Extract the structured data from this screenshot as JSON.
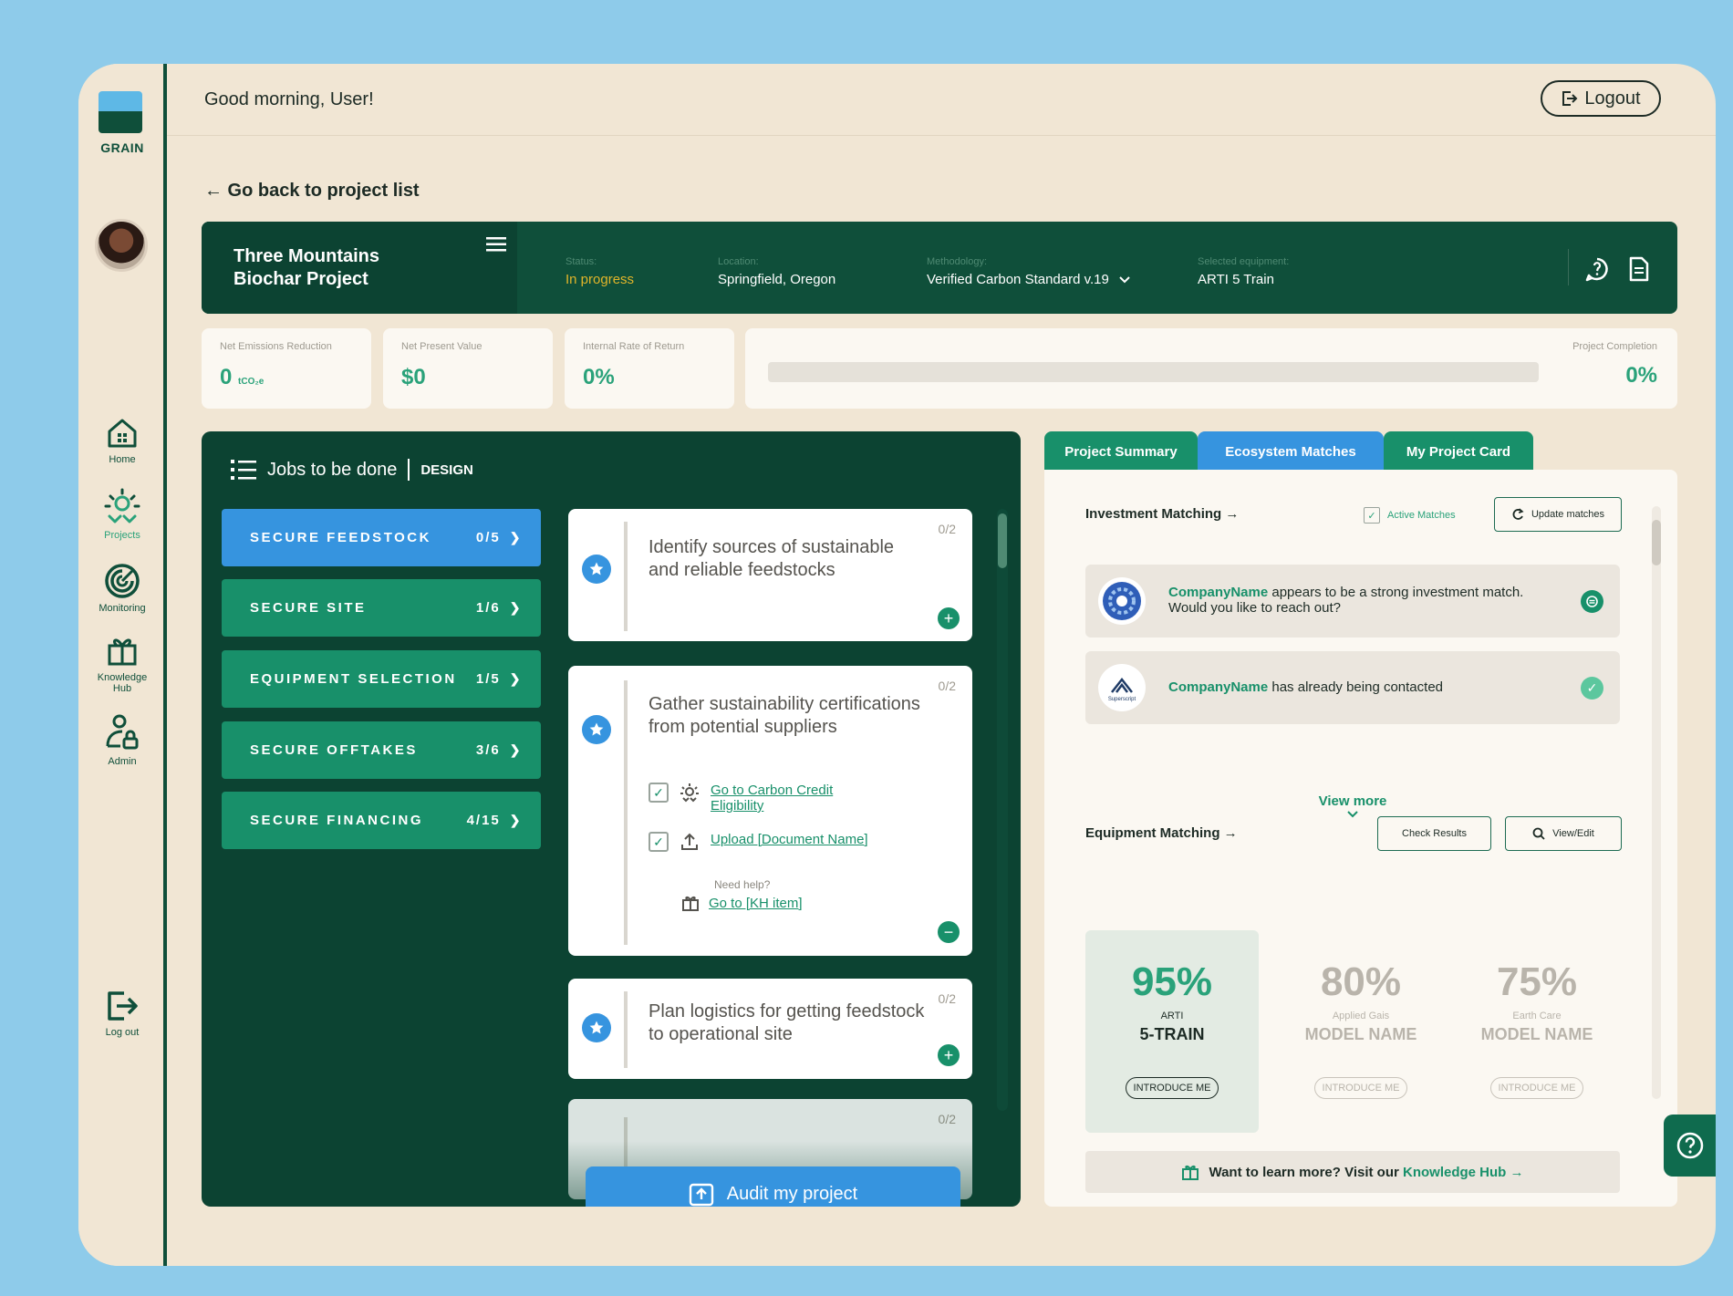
{
  "app": {
    "logo_text": "GRAIN"
  },
  "nav": [
    {
      "label": "Home",
      "icon": "home-icon"
    },
    {
      "label": "Projects",
      "icon": "projects-icon",
      "active": true
    },
    {
      "label": "Monitoring",
      "icon": "monitoring-icon"
    },
    {
      "label": "Knowledge Hub",
      "icon": "knowledge-hub-icon"
    },
    {
      "label": "Admin",
      "icon": "admin-icon"
    },
    {
      "label": "Log out",
      "icon": "logout-icon"
    }
  ],
  "header": {
    "greeting": "Good morning, User!",
    "logout_label": "Logout"
  },
  "back_link": "← Go back to project list",
  "project": {
    "title": "Three Mountains Biochar Project",
    "status_label": "Status:",
    "status_value": "In progress",
    "location_label": "Location:",
    "location_value": "Springfield, Oregon",
    "methodology_label": "Methodology:",
    "methodology_value": "Verified Carbon Standard v.19",
    "equipment_label": "Selected equipment:",
    "equipment_value": "ARTI 5 Train"
  },
  "metrics": [
    {
      "label": "Net Emissions Reduction",
      "value": "0",
      "unit": "tCO₂e"
    },
    {
      "label": "Net Present Value",
      "value": "$0"
    },
    {
      "label": "Internal Rate of Return",
      "value": "0%"
    }
  ],
  "completion": {
    "label": "Project Completion",
    "value": "0%",
    "fraction": 0
  },
  "jobs": {
    "title": "Jobs to be done",
    "phase": "DESIGN",
    "items": [
      {
        "name": "SECURE FEEDSTOCK",
        "count": "0/5",
        "active": true
      },
      {
        "name": "SECURE SITE",
        "count": "1/6"
      },
      {
        "name": "EQUIPMENT SELECTION",
        "count": "1/5"
      },
      {
        "name": "SECURE OFFTAKES",
        "count": "3/6"
      },
      {
        "name": "SECURE FINANCING",
        "count": "4/15"
      }
    ]
  },
  "tasks": [
    {
      "text": "Identify sources of sustainable and reliable feedstocks",
      "count": "0/2"
    },
    {
      "text": "Gather sustainability certifications from potential suppliers",
      "count": "0/2",
      "subtasks": [
        {
          "label": "Go to Carbon Credit Eligibility",
          "icon": "projects-icon"
        },
        {
          "label": "Upload [Document Name]",
          "icon": "upload-icon"
        }
      ],
      "help_label": "Need help?",
      "help_link": "Go to [KH item]"
    },
    {
      "text": "Plan logistics for getting feedstock to operational site",
      "count": "0/2"
    },
    {
      "count": "0/2"
    }
  ],
  "audit_label": "Audit my project",
  "tabs": [
    {
      "label": "Project Summary"
    },
    {
      "label": "Ecosystem Matches",
      "active": true
    },
    {
      "label": "My Project Card"
    }
  ],
  "investment": {
    "title": "Investment Matching →",
    "active_matches_label": "Active Matches",
    "update_label": "Update matches",
    "matches": [
      {
        "company": "CompanyName",
        "text": " appears to be a strong investment match. Would you like to reach out?",
        "status": "pending"
      },
      {
        "company": "CompanyName",
        "text": " has already being contacted",
        "status": "contacted",
        "logo_text": "Superscript"
      }
    ],
    "view_more": "View more"
  },
  "equipment": {
    "title": "Equipment Matching →",
    "check_label": "Check Results",
    "view_edit_label": "View/Edit",
    "items": [
      {
        "pct": "95%",
        "brand": "ARTI",
        "model": "5-TRAIN",
        "intro": "INTRODUCE ME",
        "best": true
      },
      {
        "pct": "80%",
        "brand": "Applied Gais",
        "model": "MODEL NAME",
        "intro": "INTRODUCE ME"
      },
      {
        "pct": "75%",
        "brand": "Earth Care",
        "model": "MODEL NAME",
        "intro": "INTRODUCE ME"
      }
    ]
  },
  "learn_more": {
    "prefix": "Want to learn more? Visit our ",
    "link": "Knowledge Hub",
    "suffix": " →"
  },
  "colors": {
    "dark_green": "#0f4f3a",
    "accent_green": "#2aa27a",
    "button_green": "#18906a",
    "blue": "#3694df",
    "status_yellow": "#e1b52a",
    "background": "#f1e6d4"
  }
}
